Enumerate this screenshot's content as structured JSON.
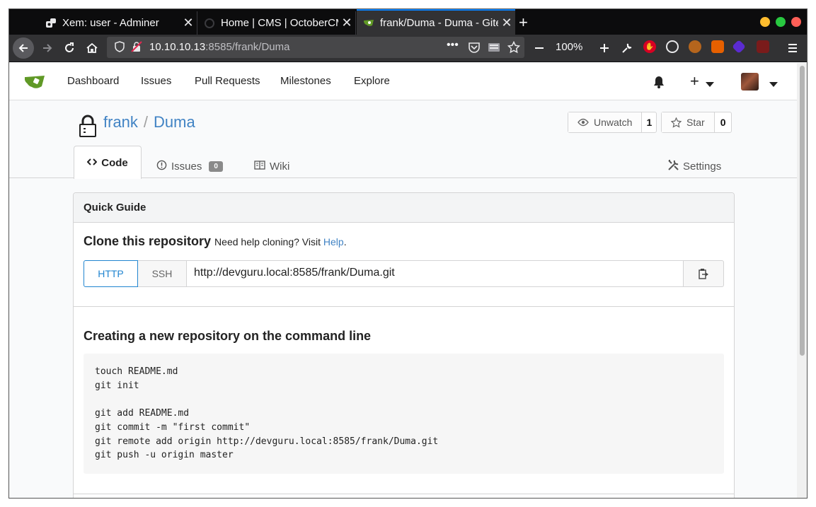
{
  "browser": {
    "tabs": [
      {
        "title": "Xem: user - Adminer",
        "close": "✕"
      },
      {
        "title": "Home | CMS | OctoberCMS",
        "close": "✕"
      },
      {
        "title": "frank/Duma - Duma - Gitea",
        "close": "✕"
      }
    ],
    "new_tab": "+",
    "url_host": "10.10.10.13",
    "url_rest": ":8585/frank/Duma",
    "zoom": "100%",
    "page_actions": "•••",
    "colors": {
      "close": "#ff5f57",
      "min": "#febc2e",
      "max": "#28c840",
      "accent": "#0a84ff"
    }
  },
  "gitea_nav": {
    "items": [
      "Dashboard",
      "Issues",
      "Pull Requests",
      "Milestones",
      "Explore"
    ],
    "plus": "+"
  },
  "repo": {
    "owner": "frank",
    "slash": "/",
    "name": "Duma",
    "watch_label": "Unwatch",
    "watch_count": "1",
    "star_label": "Star",
    "star_count": "0"
  },
  "repo_tabs": {
    "code": "Code",
    "issues": "Issues",
    "issues_count": "0",
    "wiki": "Wiki",
    "settings": "Settings"
  },
  "quick_guide": {
    "title": "Quick Guide",
    "clone_title": "Clone this repository",
    "clone_help": "Need help cloning? Visit ",
    "help_link": "Help",
    "period": ".",
    "http_label": "HTTP",
    "ssh_label": "SSH",
    "clone_url": "http://devguru.local:8585/frank/Duma.git",
    "new_repo_title": "Creating a new repository on the command line",
    "commands": "touch README.md\ngit init\n\ngit add README.md\ngit commit -m \"first commit\"\ngit remote add origin http://devguru.local:8585/frank/Duma.git\ngit push -u origin master"
  }
}
